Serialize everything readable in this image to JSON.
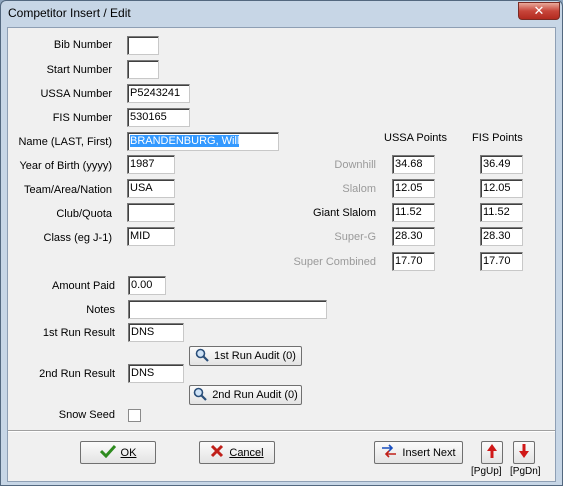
{
  "window": {
    "title": "Competitor Insert / Edit",
    "close_label": "✕"
  },
  "labels": {
    "bib": "Bib Number",
    "start": "Start Number",
    "ussa": "USSA Number",
    "fis": "FIS Number",
    "name": "Name (LAST, First)",
    "yob": "Year of Birth (yyyy)",
    "team": "Team/Area/Nation",
    "club": "Club/Quota",
    "class": "Class (eg J-1)",
    "amount": "Amount Paid",
    "notes": "Notes",
    "run1": "1st Run Result",
    "run2": "2nd Run Result",
    "snowseed": "Snow Seed"
  },
  "fields": {
    "bib": "",
    "start": "",
    "ussa": "P5243241",
    "fis": "530165",
    "name": "BRANDENBURG, Will",
    "yob": "1987",
    "team": "USA",
    "club": "",
    "class": "MID",
    "amount": "0.00",
    "notes": "",
    "run1": "DNS",
    "run2": "DNS"
  },
  "points": {
    "ussa_header": "USSA Points",
    "fis_header": "FIS Points",
    "rows": [
      {
        "event": "Downhill",
        "ussa": "34.68",
        "fis": "36.49",
        "enabled": false
      },
      {
        "event": "Slalom",
        "ussa": "12.05",
        "fis": "12.05",
        "enabled": false
      },
      {
        "event": "Giant Slalom",
        "ussa": "11.52",
        "fis": "11.52",
        "enabled": true
      },
      {
        "event": "Super-G",
        "ussa": "28.30",
        "fis": "28.30",
        "enabled": false
      },
      {
        "event": "Super Combined",
        "ussa": "17.70",
        "fis": "17.70",
        "enabled": false
      }
    ]
  },
  "buttons": {
    "audit1": "1st Run Audit (0)",
    "audit2": "2nd Run Audit (0)",
    "ok": "OK",
    "cancel": "Cancel",
    "insert_next": "Insert Next",
    "pgup": "[PgUp]",
    "pgdn": "[PgDn]"
  },
  "snow_seed_checked": false,
  "colors": {
    "selection": "#3399ff",
    "ok_check": "#2e8b1f",
    "cancel_x": "#c0201a",
    "arrows": "#d01818"
  }
}
